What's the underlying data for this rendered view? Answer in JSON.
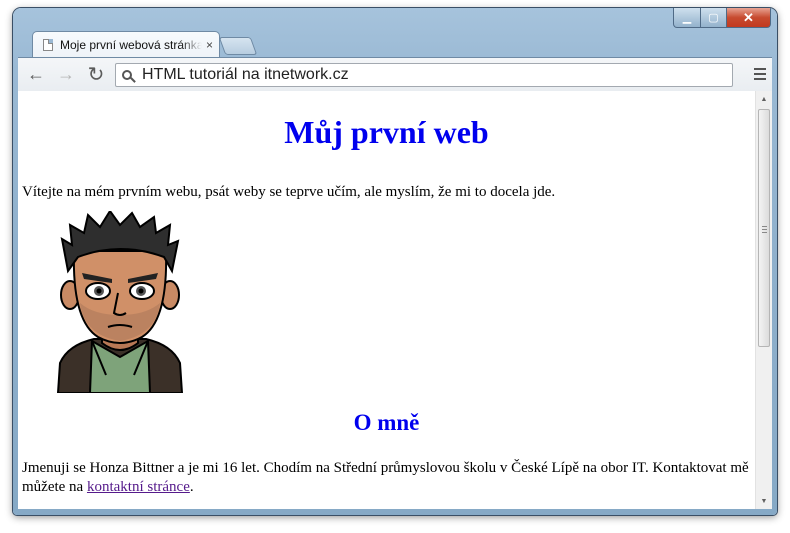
{
  "browser": {
    "tab_title": "Moje první webová stránka",
    "tab_close": "×",
    "address": "HTML tutoriál na itnetwork.cz",
    "back_glyph": "←",
    "forward_glyph": "→",
    "reload_glyph": "↻"
  },
  "window_controls": {
    "minimize": "▁",
    "maximize": "▢",
    "close": "✕"
  },
  "page": {
    "heading": "Můj první web",
    "intro": "Vítejte na mém prvním webu, psát weby se teprve učím, ale myslím, že mi to docela jde.",
    "section_heading": "O mně",
    "about_text": "Jmenuji se Honza Bittner a je mi 16 let. Chodím na Střední průmyslovou školu v České Lípě na obor IT. Kontaktovat mě můžete na ",
    "contact_link": "kontaktní stránce",
    "about_end": "."
  },
  "colors": {
    "heading": "#0000ee",
    "visited_link": "#551a8b"
  }
}
